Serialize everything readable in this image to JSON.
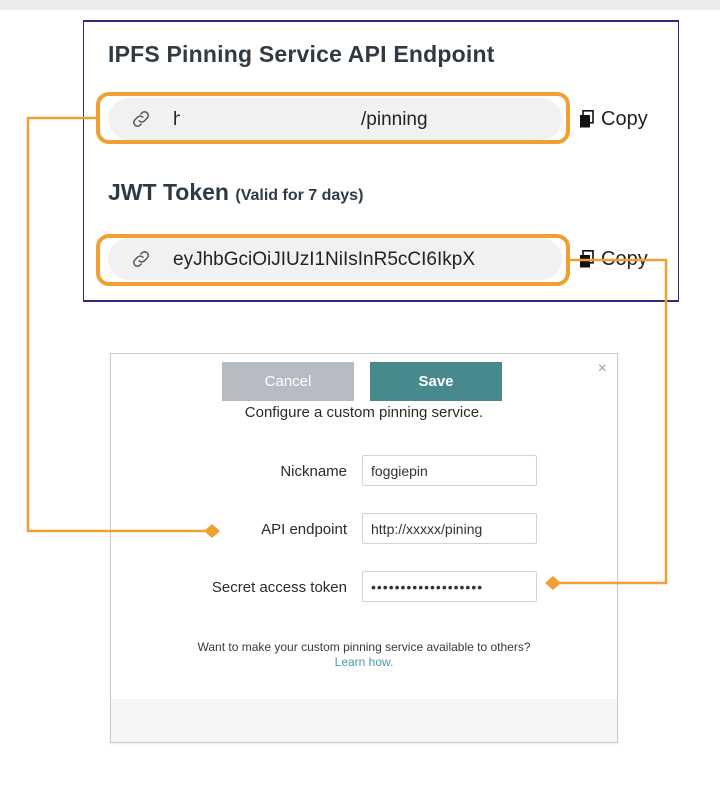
{
  "panel": {
    "endpoint_title": "IPFS Pinning Service API Endpoint",
    "endpoint_value_start": "https://",
    "endpoint_value_end": "/pinning",
    "jwt_title": "JWT Token",
    "jwt_subtitle": "(Valid for 7 days)",
    "jwt_value": "eyJhbGciOiJIUzI1NiIsInR5cCI6IkpX",
    "copy_label": "Copy"
  },
  "modal": {
    "close_symbol": "×",
    "heading": "Configure a custom pinning service.",
    "nickname_label": "Nickname",
    "nickname_value": "foggiepin",
    "endpoint_label": "API endpoint",
    "endpoint_value": "http://xxxxx/pining",
    "token_label": "Secret access token",
    "token_value": "•••••••••••••••••••",
    "note_text": "Want to make your custom pinning service available to others?",
    "learn_link": "Learn how.",
    "cancel_label": "Cancel",
    "save_label": "Save"
  },
  "colors": {
    "highlight": "#f0a030",
    "panel_border": "#2e2a7c",
    "save_button": "#47898c",
    "cancel_button": "#b7bcc2",
    "link": "#4a9aa6"
  },
  "icons": [
    "link-icon",
    "copy-icon",
    "close-icon"
  ]
}
